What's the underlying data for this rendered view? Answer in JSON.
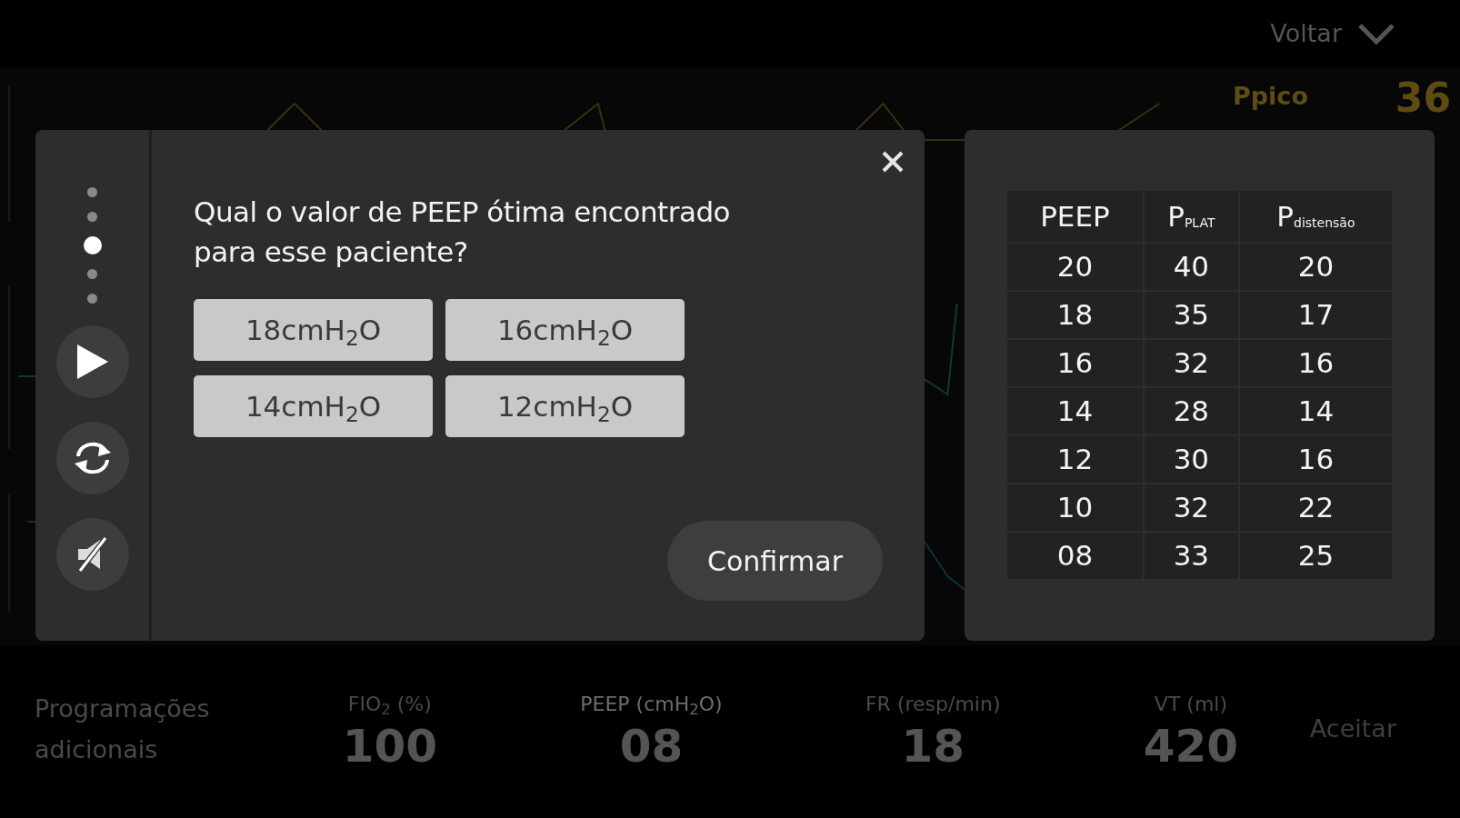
{
  "top_bar": {
    "back_label": "Voltar"
  },
  "monitor": {
    "parameter": {
      "label": "Ppico",
      "value": "36"
    }
  },
  "quiz": {
    "steps": [
      {
        "selected": false
      },
      {
        "selected": false
      },
      {
        "selected": true
      },
      {
        "selected": false
      },
      {
        "selected": false
      }
    ],
    "question": "Qual o valor de PEEP ótima encontrado para esse paciente?",
    "options": [
      {
        "label": "18cmH$_{2}$O",
        "selected": false
      },
      {
        "label": "16cmH$_{2}$O",
        "selected": false
      },
      {
        "label": "14cmH$_{2}$O",
        "selected": false
      },
      {
        "label": "12cmH$_{2}$O",
        "selected": false
      }
    ],
    "confirm_label": "Confirmar"
  },
  "table": {
    "columns": [
      "PEEP",
      "P$_{PLAT}$",
      "P$_{distensão}$"
    ],
    "rows": [
      [
        "20",
        "40",
        "20"
      ],
      [
        "18",
        "35",
        "17"
      ],
      [
        "16",
        "32",
        "16"
      ],
      [
        "14",
        "28",
        "14"
      ],
      [
        "12",
        "30",
        "16"
      ],
      [
        "10",
        "32",
        "22"
      ],
      [
        "08",
        "33",
        "25"
      ]
    ]
  },
  "settings_bar": {
    "title": "Programações adicionais",
    "params": [
      {
        "label": "FIO$_{2}$ (%)",
        "value": "100",
        "selected": false
      },
      {
        "label": "PEEP (cmH$_{2}$O)",
        "value": "08",
        "selected": true
      },
      {
        "label": "FR (resp/min)",
        "value": "18",
        "selected": false
      },
      {
        "label": "VT (ml)",
        "value": "420",
        "selected": false
      }
    ],
    "accept_label": "Aceitar"
  }
}
